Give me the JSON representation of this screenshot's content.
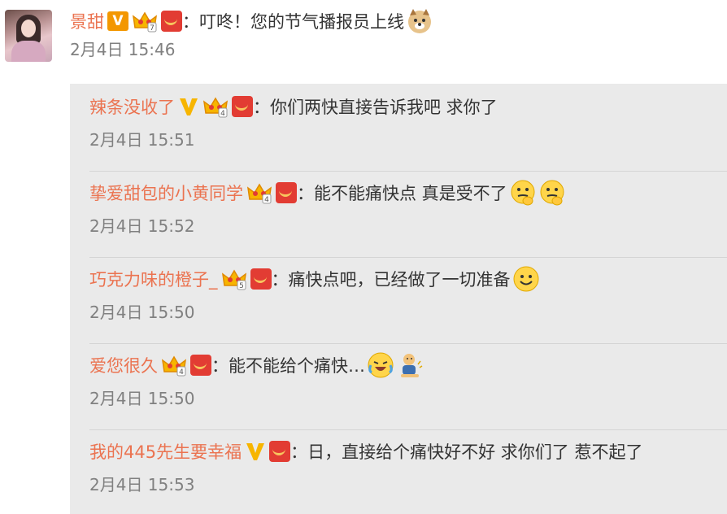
{
  "main": {
    "username": "景甜",
    "text": "叮咚！您的节气播报员上线",
    "time": "2月4日 15:46"
  },
  "colon": "：",
  "vip_label": "V",
  "replies": [
    {
      "username": "辣条没收了",
      "text": "你们两快直接告诉我吧  求你了",
      "time": "2月4日 15:51"
    },
    {
      "username": "挚爱甜包的小黄同学",
      "text": "能不能痛快点 真是受不了",
      "time": "2月4日 15:52"
    },
    {
      "username": "巧克力味的橙子_",
      "text": "痛快点吧，已经做了一切准备",
      "time": "2月4日 15:50"
    },
    {
      "username": "爱您很久",
      "text": "能不能给个痛快…",
      "time": "2月4日 15:50"
    },
    {
      "username": "我的445先生要幸福",
      "text": "日，直接给个痛快好不好  求你们了  惹不起了",
      "time": "2月4日 15:53"
    }
  ],
  "icons": {
    "vip": "vip-badge-icon",
    "crown": "crown-level-icon",
    "redpacket": "red-packet-icon",
    "doge": "doge-emoji-icon",
    "think": "thinking-emoji-icon",
    "smile": "smile-emoji-icon",
    "laugh_cry": "laugh-cry-emoji-icon",
    "squat": "squat-emoji-icon"
  },
  "colors": {
    "username": "#eb7350",
    "vip": "#f39700",
    "redpacket": "#e23c33",
    "reply_bg": "#eaeaea"
  }
}
